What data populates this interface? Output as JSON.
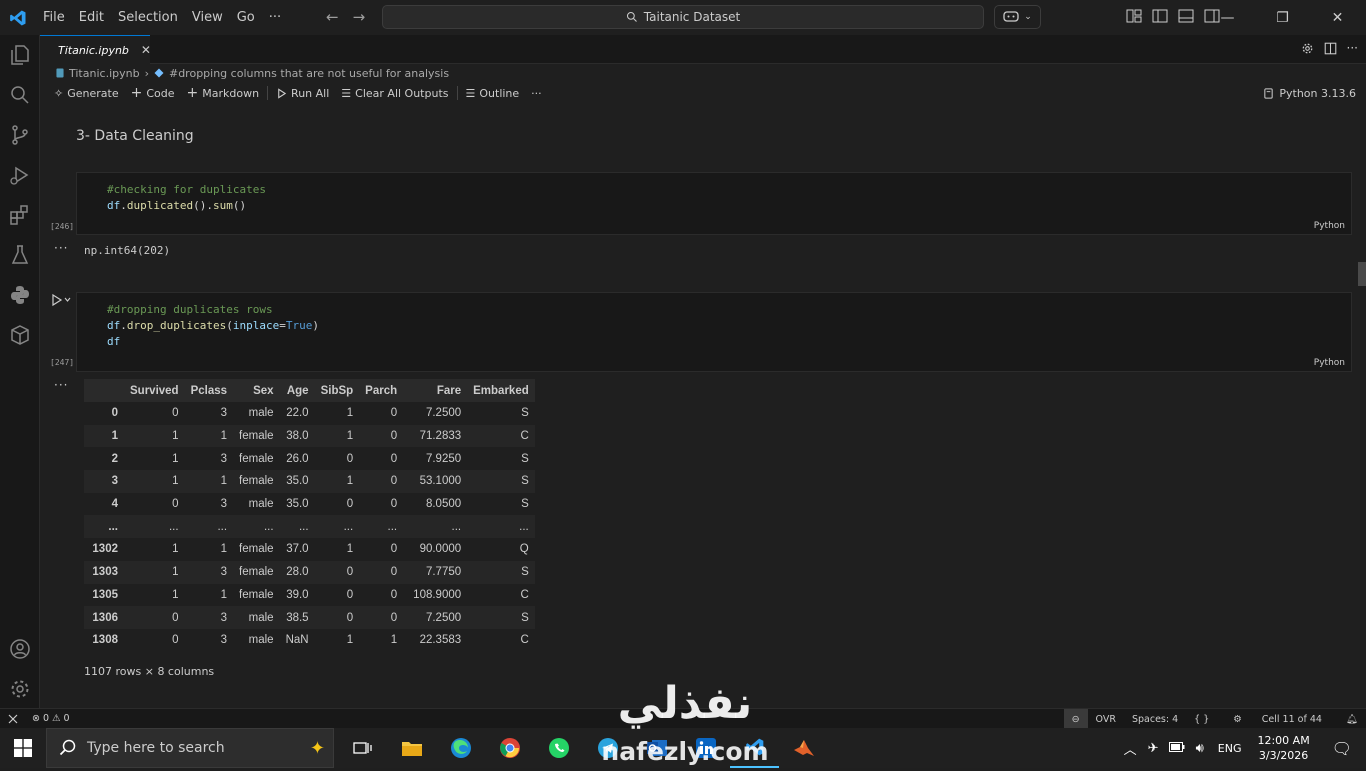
{
  "menu": [
    "File",
    "Edit",
    "Selection",
    "View",
    "Go",
    "···"
  ],
  "search": {
    "text": "Taitanic Dataset"
  },
  "tab": {
    "name": "Titanic.ipynb",
    "close": "✕"
  },
  "breadcrumb": {
    "file": "Titanic.ipynb",
    "section": "#dropping columns that are not useful for analysis"
  },
  "toolbar": {
    "generate": "Generate",
    "code": "Code",
    "markdown": "Markdown",
    "run_all": "Run All",
    "clear_outputs": "Clear All Outputs",
    "outline": "Outline",
    "more": "···",
    "kernel": "Python 3.13.6"
  },
  "markdown_heading": "3- Data Cleaning",
  "cell1": {
    "comment": "#checking for duplicates",
    "var": "df",
    "call1": "duplicated",
    "call2": "sum",
    "exec_count": "[246]",
    "lang": "Python",
    "output": "np.int64(202)"
  },
  "cell2": {
    "comment": "#dropping duplicates rows",
    "var": "df",
    "call": "drop_duplicates",
    "arg": "inplace",
    "argval": "True",
    "line3": "df",
    "exec_count": "[247]",
    "lang": "Python"
  },
  "output_dots": "···",
  "dataframe": {
    "columns": [
      "",
      "Survived",
      "Pclass",
      "Sex",
      "Age",
      "SibSp",
      "Parch",
      "Fare",
      "Embarked"
    ],
    "rows": [
      [
        "0",
        "0",
        "3",
        "male",
        "22.0",
        "1",
        "0",
        "7.2500",
        "S"
      ],
      [
        "1",
        "1",
        "1",
        "female",
        "38.0",
        "1",
        "0",
        "71.2833",
        "C"
      ],
      [
        "2",
        "1",
        "3",
        "female",
        "26.0",
        "0",
        "0",
        "7.9250",
        "S"
      ],
      [
        "3",
        "1",
        "1",
        "female",
        "35.0",
        "1",
        "0",
        "53.1000",
        "S"
      ],
      [
        "4",
        "0",
        "3",
        "male",
        "35.0",
        "0",
        "0",
        "8.0500",
        "S"
      ],
      [
        "...",
        "...",
        "...",
        "...",
        "...",
        "...",
        "...",
        "...",
        "..."
      ],
      [
        "1302",
        "1",
        "1",
        "female",
        "37.0",
        "1",
        "0",
        "90.0000",
        "Q"
      ],
      [
        "1303",
        "1",
        "3",
        "female",
        "28.0",
        "0",
        "0",
        "7.7750",
        "S"
      ],
      [
        "1305",
        "1",
        "1",
        "female",
        "39.0",
        "0",
        "0",
        "108.9000",
        "C"
      ],
      [
        "1306",
        "0",
        "3",
        "male",
        "38.5",
        "0",
        "0",
        "7.2500",
        "S"
      ],
      [
        "1308",
        "0",
        "3",
        "male",
        "NaN",
        "1",
        "1",
        "22.3583",
        "C"
      ]
    ],
    "shape": "1107 rows × 8 columns"
  },
  "status": {
    "errors": "0",
    "warnings": "0",
    "ovr": "OVR",
    "spaces": "Spaces: 4",
    "braces": "{ }",
    "cell": "Cell 11 of 44"
  },
  "taskbar": {
    "search_placeholder": "Type here to search",
    "lang": "ENG",
    "time": "12:00 AM",
    "date": "3/3/2026"
  },
  "watermark": {
    "arabic": "نفذلي",
    "latin": "nafezly.com"
  },
  "colors": {
    "accent": "#0078d4",
    "comment": "#6a9955",
    "variable": "#9cdcfe",
    "function": "#dcdcaa",
    "keyword": "#569cd6"
  }
}
